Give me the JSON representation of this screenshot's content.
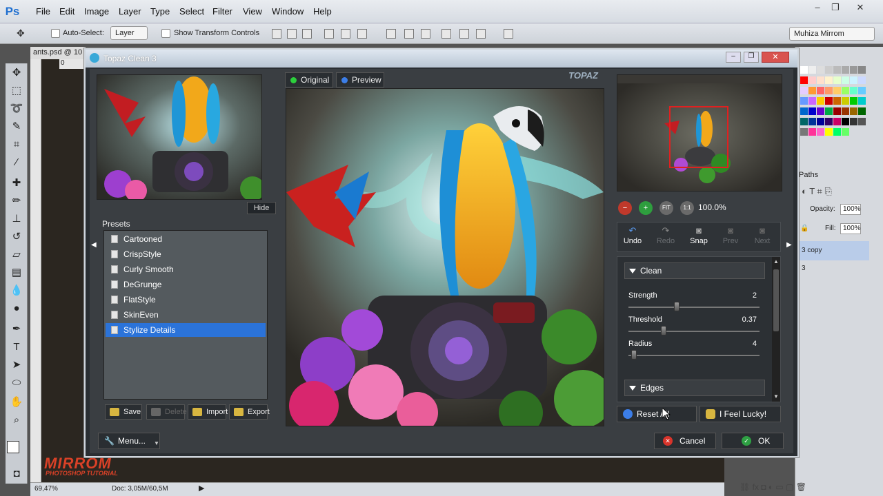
{
  "ps": {
    "logo": "Ps",
    "menu": [
      "File",
      "Edit",
      "Image",
      "Layer",
      "Type",
      "Select",
      "Filter",
      "View",
      "Window",
      "Help"
    ],
    "window_controls": [
      "–",
      "❐",
      "✕"
    ],
    "options": {
      "auto_select_label": "Auto-Select:",
      "auto_select_value": "Layer",
      "transform_label": "Show Transform Controls",
      "workspace": "Muhiza Mirrom"
    },
    "doc_tab": "ants.psd @ 10",
    "ruler_zero": "0",
    "status": {
      "zoom": "69,47%",
      "doc": "Doc: 3,05M/60,5M"
    },
    "layers": {
      "tab": "Paths",
      "opacity_label": "Opacity:",
      "opacity_value": "100%",
      "fill_label": "Fill:",
      "fill_value": "100%",
      "layer_name": "3 copy",
      "layer_name2": "3"
    },
    "tools": [
      "move",
      "marquee",
      "lasso",
      "quick-select",
      "crop",
      "eyedropper",
      "healing",
      "brush",
      "stamp",
      "history-brush",
      "eraser",
      "gradient",
      "blur",
      "dodge",
      "pen",
      "type",
      "path-select",
      "shape",
      "hand",
      "zoom"
    ]
  },
  "watermark": {
    "title": "MIRROM",
    "subtitle": "PHOTOSHOP TUTORIAL"
  },
  "topaz": {
    "title": "Topaz Clean 3",
    "hide_label": "Hide",
    "presets_label": "Presets",
    "presets": [
      "Cartooned",
      "CrispStyle",
      "Curly Smooth",
      "DeGrunge",
      "FlatStyle",
      "SkinEven",
      "Stylize Details"
    ],
    "selected_preset": "Stylize Details",
    "preset_buttons": [
      "Save",
      "Delete",
      "Import",
      "Export"
    ],
    "view_tabs": [
      "Original",
      "Preview"
    ],
    "logo": "TOPAZ",
    "zoom_buttons": [
      "−",
      "+",
      "FIT",
      "1:1"
    ],
    "zoom_level": "100.0%",
    "history": [
      "Undo",
      "Redo",
      "Snap",
      "Prev",
      "Next"
    ],
    "sections": {
      "clean": "Clean",
      "edges": "Edges"
    },
    "sliders": [
      {
        "label": "Strength",
        "value": "2",
        "level": 0.36
      },
      {
        "label": "Threshold",
        "value": "0.37",
        "level": 0.26
      },
      {
        "label": "Radius",
        "value": "4",
        "level": 0.02
      }
    ],
    "reset_label": "Reset All",
    "lucky_label": "I Feel Lucky!",
    "menu_label": "Menu...",
    "cancel_label": "Cancel",
    "ok_label": "OK"
  }
}
